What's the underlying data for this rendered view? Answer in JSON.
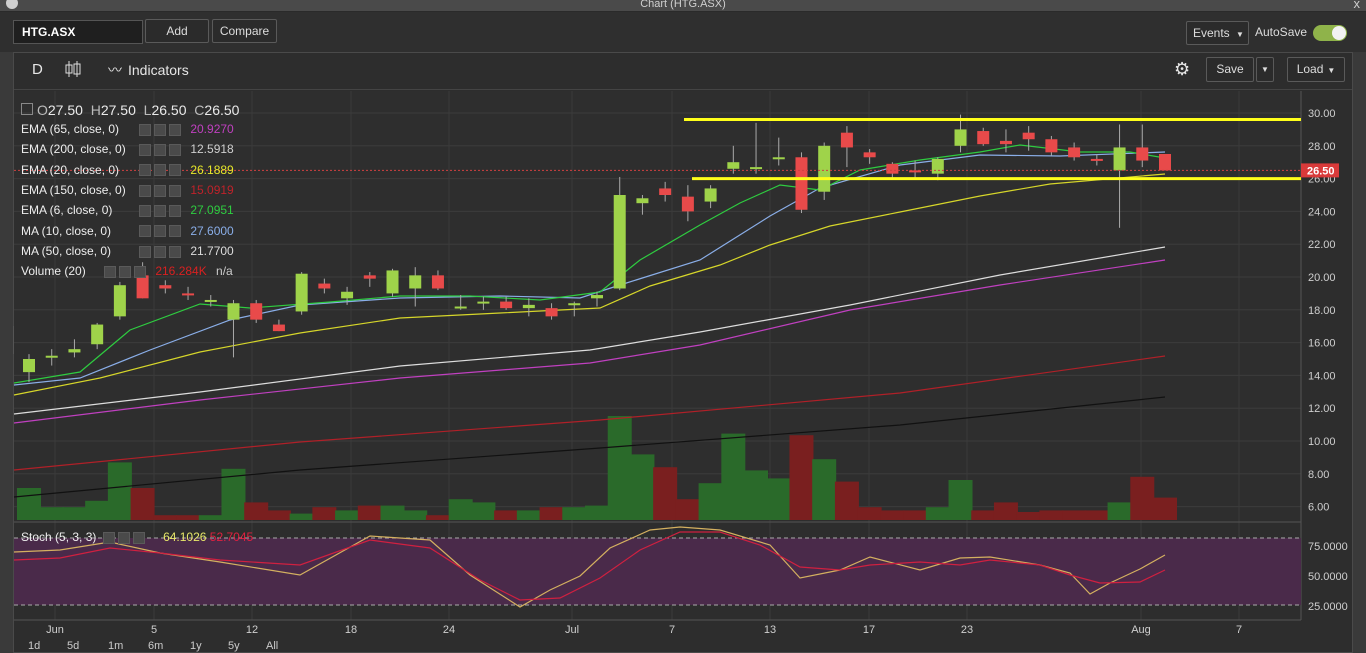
{
  "window": {
    "title": "Chart (HTG.ASX)",
    "close": "x"
  },
  "topbar": {
    "symbol": "HTG.ASX",
    "add": "Add",
    "compare": "Compare",
    "events": "Events",
    "autosave": "AutoSave"
  },
  "toolbar": {
    "period": "D",
    "indicators": "Indicators",
    "save": "Save",
    "load": "Load"
  },
  "ohlc": {
    "o_label": "O",
    "o": "27.50",
    "h_label": "H",
    "h": "27.50",
    "l_label": "L",
    "l": "26.50",
    "c_label": "C",
    "c": "26.50"
  },
  "legend": [
    {
      "name": "EMA (65, close, 0)",
      "value": "20.9270",
      "color": "#c040c0"
    },
    {
      "name": "EMA (200, close, 0)",
      "value": "12.5918",
      "color": "#111111"
    },
    {
      "name": "EMA (20, close, 0)",
      "value": "26.1889",
      "color": "#e6e62a"
    },
    {
      "name": "EMA (150, close, 0)",
      "value": "15.0919",
      "color": "#c0222a"
    },
    {
      "name": "EMA (6, close, 0)",
      "value": "27.0951",
      "color": "#2ecc40"
    },
    {
      "name": "MA (10, close, 0)",
      "value": "27.6000",
      "color": "#8aaee8"
    },
    {
      "name": "MA (50, close, 0)",
      "value": "21.7700",
      "color": "#dddddd"
    },
    {
      "name": "Volume (20)",
      "value": "216.284K",
      "extra": "n/a",
      "color": "#d92020"
    }
  ],
  "stoch": {
    "name": "Stoch (5, 3, 3)",
    "k": "64.1026",
    "d": "52.7045",
    "k_color": "#e0c060",
    "d_color": "#e02040"
  },
  "price_label": "26.50",
  "ranges": [
    "1d",
    "5d",
    "1m",
    "6m",
    "1y",
    "5y",
    "All"
  ],
  "colors": {
    "up": "#9fd34a",
    "down": "#e84a4a",
    "vol_up": "#2a6a2a",
    "vol_down": "#7a1f1f",
    "stoch_band": "#4a2a4a",
    "yellow_line": "#ffff1a"
  },
  "chart_data": {
    "type": "candlestick",
    "x_ticks": [
      "Jun",
      "5",
      "12",
      "18",
      "24",
      "Jul",
      "7",
      "13",
      "17",
      "23",
      "Aug",
      "7"
    ],
    "y_ticks": [
      "30.00",
      "28.00",
      "26.00",
      "24.00",
      "22.00",
      "20.00",
      "18.00",
      "16.00",
      "14.00",
      "12.00",
      "10.00",
      "8.00",
      "6.00"
    ],
    "stoch_ticks": [
      "75.0000",
      "50.0000",
      "25.0000"
    ],
    "ylim": [
      5,
      30.5
    ],
    "resistance": 29.6,
    "support": 26.0,
    "candles": [
      {
        "o": 14.2,
        "h": 15.3,
        "l": 13.6,
        "c": 15.0
      },
      {
        "o": 15.1,
        "h": 15.6,
        "l": 14.6,
        "c": 15.2
      },
      {
        "o": 15.4,
        "h": 16.2,
        "l": 15.1,
        "c": 15.6
      },
      {
        "o": 15.9,
        "h": 17.2,
        "l": 15.6,
        "c": 17.1
      },
      {
        "o": 17.6,
        "h": 19.7,
        "l": 17.4,
        "c": 19.5
      },
      {
        "o": 20.1,
        "h": 20.9,
        "l": 18.7,
        "c": 18.7
      },
      {
        "o": 19.5,
        "h": 19.8,
        "l": 19.0,
        "c": 19.3
      },
      {
        "o": 19.0,
        "h": 19.4,
        "l": 18.6,
        "c": 18.9
      },
      {
        "o": 18.5,
        "h": 18.9,
        "l": 18.2,
        "c": 18.6
      },
      {
        "o": 17.4,
        "h": 18.6,
        "l": 15.1,
        "c": 18.4
      },
      {
        "o": 18.4,
        "h": 18.6,
        "l": 17.2,
        "c": 17.4
      },
      {
        "o": 17.1,
        "h": 17.4,
        "l": 16.7,
        "c": 16.7
      },
      {
        "o": 17.9,
        "h": 20.3,
        "l": 17.7,
        "c": 20.2
      },
      {
        "o": 19.6,
        "h": 19.9,
        "l": 19.0,
        "c": 19.3
      },
      {
        "o": 18.7,
        "h": 19.4,
        "l": 18.3,
        "c": 19.1
      },
      {
        "o": 20.1,
        "h": 20.3,
        "l": 19.4,
        "c": 19.9
      },
      {
        "o": 19.0,
        "h": 20.5,
        "l": 18.8,
        "c": 20.4
      },
      {
        "o": 19.3,
        "h": 20.6,
        "l": 18.2,
        "c": 20.1
      },
      {
        "o": 20.1,
        "h": 20.4,
        "l": 19.2,
        "c": 19.3
      },
      {
        "o": 18.2,
        "h": 18.9,
        "l": 18.0,
        "c": 18.2
      },
      {
        "o": 18.4,
        "h": 18.8,
        "l": 18.0,
        "c": 18.5
      },
      {
        "o": 18.5,
        "h": 18.8,
        "l": 18.0,
        "c": 18.1
      },
      {
        "o": 18.1,
        "h": 18.7,
        "l": 17.6,
        "c": 18.3
      },
      {
        "o": 18.1,
        "h": 18.4,
        "l": 17.4,
        "c": 17.6
      },
      {
        "o": 18.3,
        "h": 18.5,
        "l": 17.6,
        "c": 18.4
      },
      {
        "o": 18.7,
        "h": 19.1,
        "l": 18.2,
        "c": 18.9
      },
      {
        "o": 19.3,
        "h": 26.1,
        "l": 19.2,
        "c": 25.0
      },
      {
        "o": 24.5,
        "h": 25.0,
        "l": 23.8,
        "c": 24.8
      },
      {
        "o": 25.4,
        "h": 25.8,
        "l": 24.6,
        "c": 25.0
      },
      {
        "o": 24.9,
        "h": 25.6,
        "l": 23.4,
        "c": 24.0
      },
      {
        "o": 24.6,
        "h": 25.6,
        "l": 24.2,
        "c": 25.4
      },
      {
        "o": 26.6,
        "h": 28.0,
        "l": 26.3,
        "c": 27.0
      },
      {
        "o": 26.7,
        "h": 29.4,
        "l": 26.3,
        "c": 26.7
      },
      {
        "o": 27.2,
        "h": 28.5,
        "l": 26.8,
        "c": 27.3
      },
      {
        "o": 27.3,
        "h": 27.6,
        "l": 23.9,
        "c": 24.1
      },
      {
        "o": 25.2,
        "h": 28.2,
        "l": 24.7,
        "c": 28.0
      },
      {
        "o": 28.8,
        "h": 29.2,
        "l": 26.7,
        "c": 27.9
      },
      {
        "o": 27.6,
        "h": 27.8,
        "l": 26.9,
        "c": 27.3
      },
      {
        "o": 26.9,
        "h": 27.0,
        "l": 26.0,
        "c": 26.3
      },
      {
        "o": 26.5,
        "h": 27.1,
        "l": 26.0,
        "c": 26.4
      },
      {
        "o": 26.3,
        "h": 27.3,
        "l": 25.9,
        "c": 27.2
      },
      {
        "o": 28.0,
        "h": 29.9,
        "l": 27.6,
        "c": 29.0
      },
      {
        "o": 28.9,
        "h": 29.1,
        "l": 28.0,
        "c": 28.1
      },
      {
        "o": 28.3,
        "h": 29.0,
        "l": 27.6,
        "c": 28.1
      },
      {
        "o": 28.8,
        "h": 29.2,
        "l": 27.7,
        "c": 28.4
      },
      {
        "o": 28.4,
        "h": 28.6,
        "l": 27.4,
        "c": 27.6
      },
      {
        "o": 27.9,
        "h": 28.2,
        "l": 27.1,
        "c": 27.3
      },
      {
        "o": 27.2,
        "h": 27.5,
        "l": 26.8,
        "c": 27.1
      },
      {
        "o": 26.5,
        "h": 29.3,
        "l": 23.0,
        "c": 27.9
      },
      {
        "o": 27.9,
        "h": 29.3,
        "l": 26.7,
        "c": 27.1
      },
      {
        "o": 27.5,
        "h": 27.5,
        "l": 26.5,
        "c": 26.5
      }
    ],
    "volume": [
      2,
      0.8,
      0.8,
      1.2,
      3.6,
      2.0,
      0.3,
      0.3,
      0.3,
      3.2,
      1.1,
      0.6,
      0.4,
      0.8,
      0.6,
      0.9,
      0.9,
      0.6,
      0.3,
      1.3,
      1.1,
      0.6,
      0.6,
      0.8,
      0.8,
      0.9,
      6.5,
      4.1,
      3.3,
      1.3,
      2.3,
      5.4,
      3.1,
      2.6,
      5.3,
      3.8,
      2.4,
      0.8,
      0.6,
      0.6,
      0.8,
      2.5,
      0.6,
      1.1,
      0.5,
      0.6,
      0.6,
      0.6,
      1.1,
      2.7,
      1.4
    ]
  }
}
